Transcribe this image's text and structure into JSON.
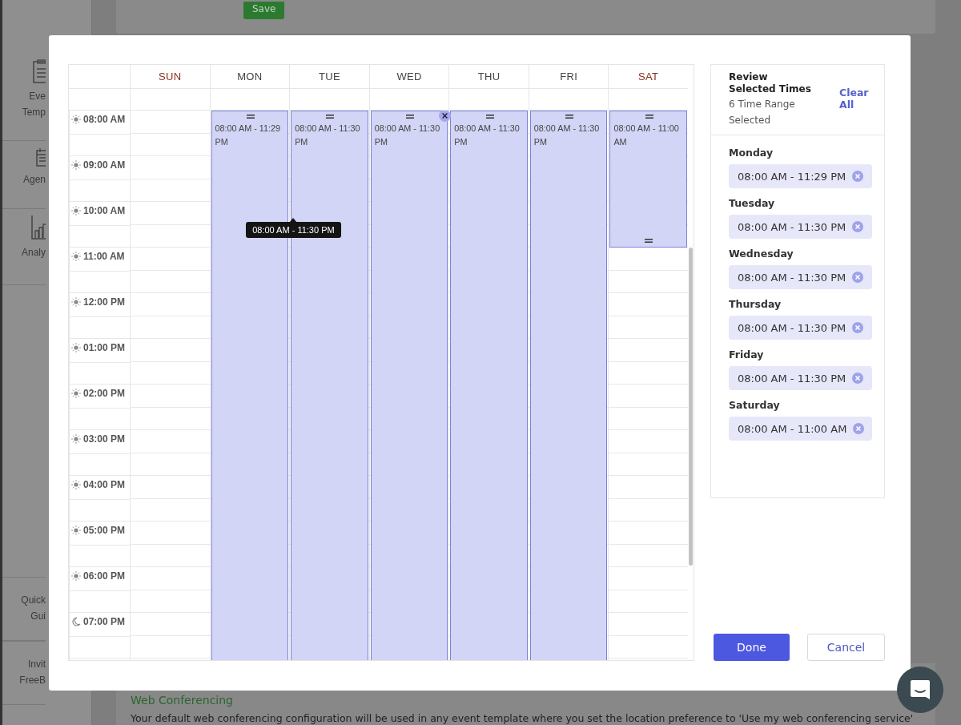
{
  "background": {
    "save_button": "Save",
    "sidebar": [
      {
        "label": [
          "Eve",
          "Temp"
        ]
      },
      {
        "label": [
          "Agen"
        ]
      },
      {
        "label": [
          "Analy"
        ]
      },
      {
        "label": [
          "Quick",
          "Gui"
        ]
      },
      {
        "label": [
          "Invit",
          "FreeB"
        ]
      }
    ],
    "section_title": "Web Conferencing",
    "section_text": "Your default web conferencing configuration will be used in any event template where you set the location preference to 'Use my web conferencing service'"
  },
  "calendar": {
    "days": [
      {
        "label": "SUN",
        "weekend": true
      },
      {
        "label": "MON",
        "weekend": false,
        "event": {
          "label": "08:00 AM - 11:29 PM",
          "delete": false
        }
      },
      {
        "label": "TUE",
        "weekend": false,
        "event": {
          "label": "08:00 AM - 11:30 PM",
          "delete": false,
          "tooltip": "08:00 AM - 11:30 PM"
        }
      },
      {
        "label": "WED",
        "weekend": false,
        "event": {
          "label": "08:00 AM - 11:30 PM",
          "delete": true
        }
      },
      {
        "label": "THU",
        "weekend": false,
        "event": {
          "label": "08:00 AM - 11:30 PM",
          "delete": false
        }
      },
      {
        "label": "FRI",
        "weekend": false,
        "event": {
          "label": "08:00 AM - 11:30 PM",
          "delete": false
        }
      },
      {
        "label": "SAT",
        "weekend": true,
        "event": {
          "label": "08:00 AM - 11:00 AM",
          "delete": false
        }
      }
    ],
    "times": [
      {
        "label": "08:00 AM",
        "kind": "day"
      },
      {
        "label": "09:00 AM",
        "kind": "day"
      },
      {
        "label": "10:00 AM",
        "kind": "day"
      },
      {
        "label": "11:00 AM",
        "kind": "day"
      },
      {
        "label": "12:00 PM",
        "kind": "day"
      },
      {
        "label": "01:00 PM",
        "kind": "day"
      },
      {
        "label": "02:00 PM",
        "kind": "day"
      },
      {
        "label": "03:00 PM",
        "kind": "day"
      },
      {
        "label": "04:00 PM",
        "kind": "day"
      },
      {
        "label": "05:00 PM",
        "kind": "day"
      },
      {
        "label": "06:00 PM",
        "kind": "day"
      },
      {
        "label": "07:00 PM",
        "kind": "night"
      }
    ]
  },
  "review": {
    "title": "Review Selected Times",
    "count": "6 Time Range Selected",
    "clear_all": "Clear All",
    "items": [
      {
        "day": "Monday",
        "range": "08:00 AM - 11:29 PM"
      },
      {
        "day": "Tuesday",
        "range": "08:00 AM - 11:30 PM"
      },
      {
        "day": "Wednesday",
        "range": "08:00 AM - 11:30 PM"
      },
      {
        "day": "Thursday",
        "range": "08:00 AM - 11:30 PM"
      },
      {
        "day": "Friday",
        "range": "08:00 AM - 11:30 PM"
      },
      {
        "day": "Saturday",
        "range": "08:00 AM - 11:00 AM"
      }
    ]
  },
  "buttons": {
    "done": "Done",
    "cancel": "Cancel"
  }
}
